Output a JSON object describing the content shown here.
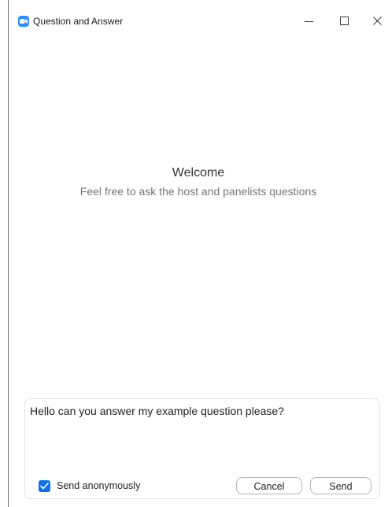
{
  "window": {
    "title": "Question and Answer",
    "icon": "zoom-app-icon",
    "controls": [
      "minimize-icon",
      "maximize-icon",
      "close-icon"
    ]
  },
  "welcome": {
    "title": "Welcome",
    "subtitle": "Feel free to ask the host and panelists questions"
  },
  "compose": {
    "question_value": "Hello can you answer my example question please?",
    "anonymous_checked": true,
    "anonymous_label": "Send anonymously",
    "cancel_label": "Cancel",
    "send_label": "Send"
  },
  "colors": {
    "accent": "#0e71eb",
    "app_icon": "#2d8cff"
  }
}
